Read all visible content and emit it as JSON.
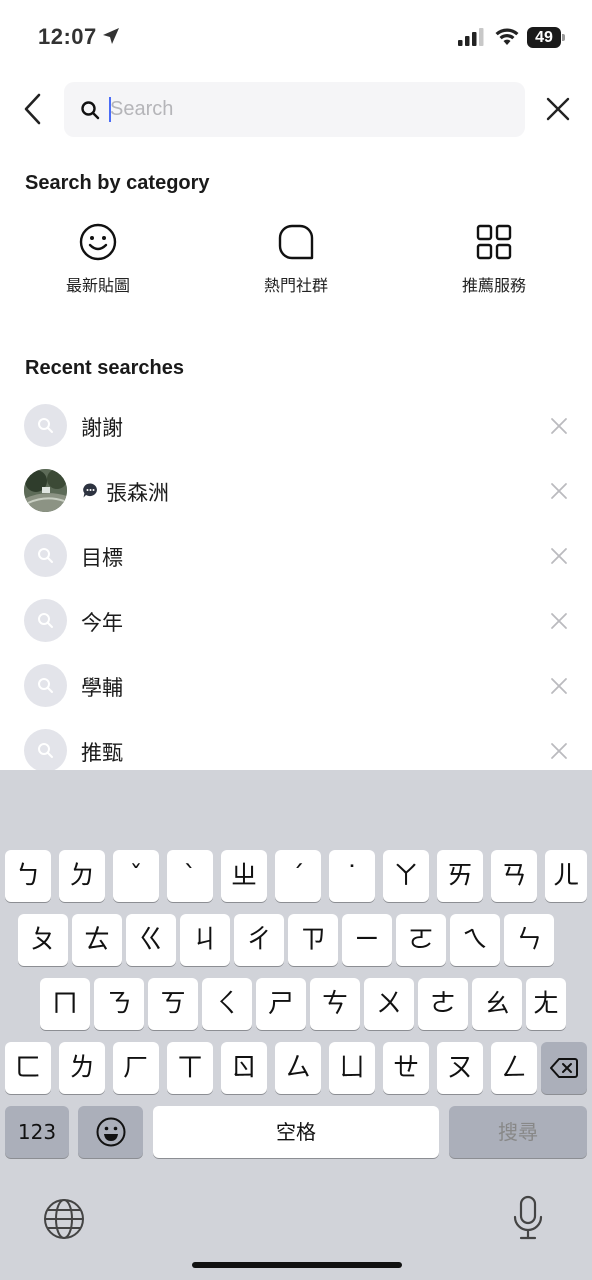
{
  "status_bar": {
    "time": "12:07",
    "battery": "49"
  },
  "search": {
    "placeholder": "Search",
    "value": ""
  },
  "category_section": {
    "title": "Search by category",
    "items": [
      {
        "label": "最新貼圖",
        "icon": "smiley-icon"
      },
      {
        "label": "熱門社群",
        "icon": "openchat-icon"
      },
      {
        "label": "推薦服務",
        "icon": "grid-icon"
      }
    ]
  },
  "recent_section": {
    "title": "Recent searches",
    "items": [
      {
        "text": "謝謝",
        "kind": "keyword"
      },
      {
        "text": "張森洲",
        "kind": "chat"
      },
      {
        "text": "目標",
        "kind": "keyword"
      },
      {
        "text": "今年",
        "kind": "keyword"
      },
      {
        "text": "學輔",
        "kind": "keyword"
      },
      {
        "text": "推甄",
        "kind": "keyword"
      }
    ]
  },
  "keyboard": {
    "row1": [
      "ㄅ",
      "ㄉ",
      "ˇ",
      "ˋ",
      "ㄓ",
      "ˊ",
      "˙",
      "ㄚ",
      "ㄞ",
      "ㄢ",
      "ㄦ"
    ],
    "row2": [
      "ㄆ",
      "ㄊ",
      "ㄍ",
      "ㄐ",
      "ㄔ",
      "ㄗ",
      "ㄧ",
      "ㄛ",
      "ㄟ",
      "ㄣ"
    ],
    "row3": [
      "ㄇ",
      "ㄋ",
      "ㄎ",
      "ㄑ",
      "ㄕ",
      "ㄘ",
      "ㄨ",
      "ㄜ",
      "ㄠ",
      "ㄤ"
    ],
    "row4": [
      "ㄈ",
      "ㄌ",
      "ㄏ",
      "ㄒ",
      "ㄖ",
      "ㄙ",
      "ㄩ",
      "ㄝ",
      "ㄡ",
      "ㄥ"
    ],
    "numbers_label": "123",
    "space_label": "空格",
    "search_label": "搜尋"
  }
}
